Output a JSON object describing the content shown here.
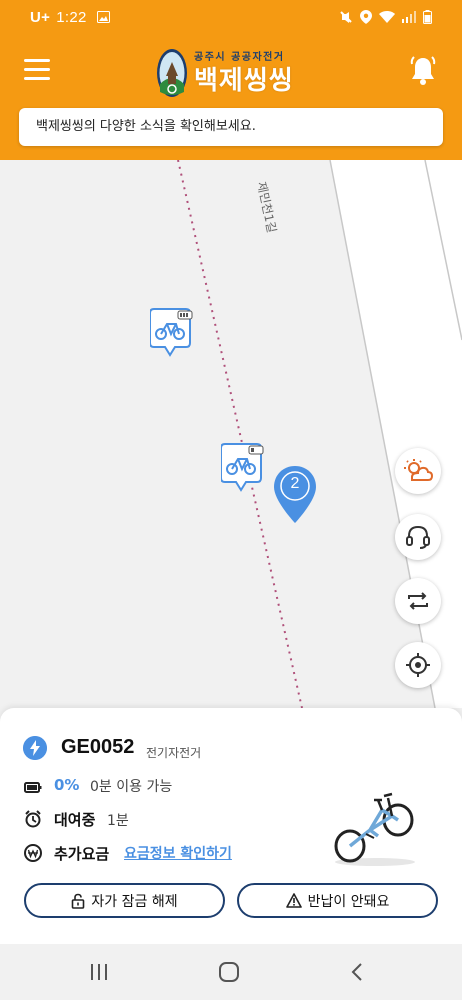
{
  "status_bar": {
    "carrier": "U+",
    "time": "1:22"
  },
  "header": {
    "logo_subtitle": "공주시 공공자전거",
    "logo_title": "백제씽씽",
    "notice": "백제씽씽의 다양한 소식을 확인해보세요."
  },
  "map": {
    "road_label": "제민천1길",
    "cluster_count": "2"
  },
  "bike_info": {
    "id": "GE0052",
    "type": "전기자전거",
    "battery_percent": "0%",
    "battery_text": "0분 이용 가능",
    "rent_status": "대여중",
    "rent_time": "1분",
    "extra_fee_label": "추가요금",
    "extra_fee_link": "요금정보 확인하기"
  },
  "actions": {
    "unlock_label": "자가 잠금 해제",
    "return_issue_label": "반납이 안돼요"
  },
  "colors": {
    "brand_orange": "#f59a12",
    "accent_blue": "#4a90e2",
    "navy": "#1d3e6e"
  }
}
